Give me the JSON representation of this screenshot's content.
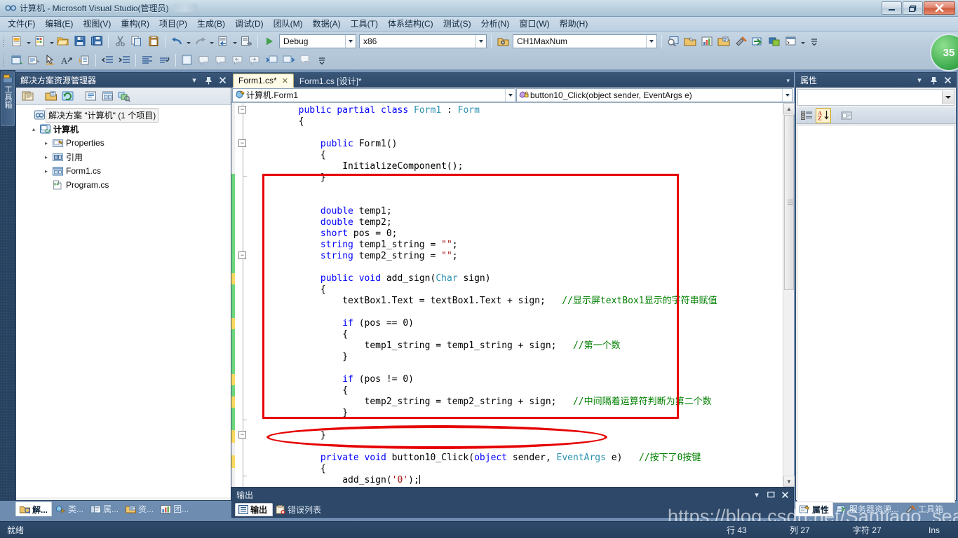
{
  "window": {
    "title": "计算机 - Microsoft Visual Studio(管理员)",
    "minimize_label": "—",
    "restore_label": "❐",
    "close_label": "✕"
  },
  "menu": {
    "items": [
      {
        "label": "文件(F)"
      },
      {
        "label": "编辑(E)"
      },
      {
        "label": "视图(V)"
      },
      {
        "label": "重构(R)"
      },
      {
        "label": "项目(P)"
      },
      {
        "label": "生成(B)"
      },
      {
        "label": "调试(D)"
      },
      {
        "label": "团队(M)"
      },
      {
        "label": "数据(A)"
      },
      {
        "label": "工具(T)"
      },
      {
        "label": "体系结构(C)"
      },
      {
        "label": "测试(S)"
      },
      {
        "label": "分析(N)"
      },
      {
        "label": "窗口(W)"
      },
      {
        "label": "帮助(H)"
      }
    ]
  },
  "toolbar": {
    "config_value": "Debug",
    "platform_value": "x86",
    "startup_project_value": "CH1MaxNum",
    "icons_row1": [
      "new-project-icon",
      "add-new-item-icon",
      "open-file-icon",
      "save-icon",
      "save-all-icon",
      "cut-icon",
      "copy-icon",
      "paste-icon",
      "undo-icon",
      "redo-icon",
      "navigate-backward-icon",
      "navigate-forward-icon",
      "start-debug-icon"
    ],
    "icons_row1_right": [
      "find-in-files-icon",
      "properties-window-icon",
      "object-browser-icon",
      "solution-explorer-icon",
      "toolbox-icon",
      "server-explorer-icon",
      "class-view-icon",
      "command-window-icon"
    ],
    "icons_row2": [
      "display-form-icon",
      "view-code-icon",
      "pointer-icon",
      "font-icon",
      "tab-order-icon",
      "decrease-indent-icon",
      "increase-indent-icon",
      "align-left-icon",
      "undo-layout-icon",
      "panel-icon",
      "comment-icon",
      "uncomment-icon",
      "bookmark-prev-icon",
      "bookmark-next-icon",
      "toggle-all-outline-icon",
      "expand-outline-icon",
      "clear-bookmarks-icon"
    ]
  },
  "badge": {
    "value": "35"
  },
  "leftdock": {
    "label": "工具箱",
    "icon": "toolbox-icon"
  },
  "solution_explorer": {
    "title": "解决方案资源管理器",
    "header_buttons": [
      "chevron-down-icon",
      "pin-icon",
      "close-icon"
    ],
    "toolbar_icons": [
      "properties-icon",
      "show-all-files-icon",
      "refresh-icon",
      "view-code-icon",
      "view-designer-icon",
      "preview-selected-items-icon"
    ],
    "tree": [
      {
        "label": "解决方案 \"计算机\" (1 个项目)",
        "icon": "solution-icon",
        "indent": 0,
        "expander": "",
        "selected": true,
        "bold": false
      },
      {
        "label": "计算机",
        "icon": "csharp-project-icon",
        "indent": 1,
        "expander": "▴",
        "selected": false,
        "bold": true
      },
      {
        "label": "Properties",
        "icon": "properties-folder-icon",
        "indent": 2,
        "expander": "▸",
        "selected": false,
        "bold": false
      },
      {
        "label": "引用",
        "icon": "references-icon",
        "indent": 2,
        "expander": "▸",
        "selected": false,
        "bold": false
      },
      {
        "label": "Form1.cs",
        "icon": "form-icon",
        "indent": 2,
        "expander": "▸",
        "selected": false,
        "bold": false
      },
      {
        "label": "Program.cs",
        "icon": "csharp-file-icon",
        "indent": 2,
        "expander": "",
        "selected": false,
        "bold": false
      }
    ]
  },
  "editor": {
    "tabs": [
      {
        "label": "Form1.cs*",
        "active": true,
        "closable": true
      },
      {
        "label": "Form1.cs [设计]*",
        "active": false,
        "closable": false
      }
    ],
    "tab_close_label": "✕",
    "tabstrip_overflow": "▾",
    "nav_type": "计算机.Form1",
    "nav_member": "button10_Click(object sender, EventArgs e)",
    "nav_type_icon": "class-icon",
    "nav_member_icon": "private-method-icon",
    "lines": [
      [
        {
          "t": "        ",
          "c": ""
        },
        {
          "t": "public",
          "c": "kw"
        },
        {
          "t": " ",
          "c": ""
        },
        {
          "t": "partial",
          "c": "kw"
        },
        {
          "t": " ",
          "c": ""
        },
        {
          "t": "class",
          "c": "kw"
        },
        {
          "t": " ",
          "c": ""
        },
        {
          "t": "Form1",
          "c": "ty"
        },
        {
          "t": " : ",
          "c": ""
        },
        {
          "t": "Form",
          "c": "ty"
        }
      ],
      [
        {
          "t": "        {",
          "c": ""
        }
      ],
      [
        {
          "t": "",
          "c": ""
        }
      ],
      [
        {
          "t": "            ",
          "c": ""
        },
        {
          "t": "public",
          "c": "kw"
        },
        {
          "t": " Form1()",
          "c": ""
        }
      ],
      [
        {
          "t": "            {",
          "c": ""
        }
      ],
      [
        {
          "t": "                InitializeComponent();",
          "c": ""
        }
      ],
      [
        {
          "t": "            }",
          "c": ""
        }
      ],
      [
        {
          "t": "",
          "c": ""
        }
      ],
      [
        {
          "t": "",
          "c": ""
        }
      ],
      [
        {
          "t": "            ",
          "c": ""
        },
        {
          "t": "double",
          "c": "kw"
        },
        {
          "t": " temp1;",
          "c": ""
        }
      ],
      [
        {
          "t": "            ",
          "c": ""
        },
        {
          "t": "double",
          "c": "kw"
        },
        {
          "t": " temp2;",
          "c": ""
        }
      ],
      [
        {
          "t": "            ",
          "c": ""
        },
        {
          "t": "short",
          "c": "kw"
        },
        {
          "t": " pos = 0;",
          "c": ""
        }
      ],
      [
        {
          "t": "            ",
          "c": ""
        },
        {
          "t": "string",
          "c": "kw"
        },
        {
          "t": " temp1_string = ",
          "c": ""
        },
        {
          "t": "\"\"",
          "c": "st"
        },
        {
          "t": ";",
          "c": ""
        }
      ],
      [
        {
          "t": "            ",
          "c": ""
        },
        {
          "t": "string",
          "c": "kw"
        },
        {
          "t": " temp2_string = ",
          "c": ""
        },
        {
          "t": "\"\"",
          "c": "st"
        },
        {
          "t": ";",
          "c": ""
        }
      ],
      [
        {
          "t": "",
          "c": ""
        }
      ],
      [
        {
          "t": "            ",
          "c": ""
        },
        {
          "t": "public",
          "c": "kw"
        },
        {
          "t": " ",
          "c": ""
        },
        {
          "t": "void",
          "c": "kw"
        },
        {
          "t": " add_sign(",
          "c": ""
        },
        {
          "t": "Char",
          "c": "ty"
        },
        {
          "t": " sign)",
          "c": ""
        }
      ],
      [
        {
          "t": "            {",
          "c": ""
        }
      ],
      [
        {
          "t": "                textBox1.Text = textBox1.Text + sign;   ",
          "c": ""
        },
        {
          "t": "//显示屏textBox1显示的字符串赋值",
          "c": "cm"
        }
      ],
      [
        {
          "t": "",
          "c": ""
        }
      ],
      [
        {
          "t": "                ",
          "c": ""
        },
        {
          "t": "if",
          "c": "kw"
        },
        {
          "t": " (pos == 0)",
          "c": ""
        }
      ],
      [
        {
          "t": "                {",
          "c": ""
        }
      ],
      [
        {
          "t": "                    temp1_string = temp1_string + sign;   ",
          "c": ""
        },
        {
          "t": "//第一个数",
          "c": "cm"
        }
      ],
      [
        {
          "t": "                }",
          "c": ""
        }
      ],
      [
        {
          "t": "",
          "c": ""
        }
      ],
      [
        {
          "t": "                ",
          "c": ""
        },
        {
          "t": "if",
          "c": "kw"
        },
        {
          "t": " (pos != 0)",
          "c": ""
        }
      ],
      [
        {
          "t": "                {",
          "c": ""
        }
      ],
      [
        {
          "t": "                    temp2_string = temp2_string + sign;   ",
          "c": ""
        },
        {
          "t": "//中间隔着运算符判断为第二个数",
          "c": "cm"
        }
      ],
      [
        {
          "t": "                }",
          "c": ""
        }
      ],
      [
        {
          "t": "",
          "c": ""
        }
      ],
      [
        {
          "t": "            }",
          "c": ""
        }
      ],
      [
        {
          "t": "",
          "c": ""
        }
      ],
      [
        {
          "t": "            ",
          "c": ""
        },
        {
          "t": "private",
          "c": "kw"
        },
        {
          "t": " ",
          "c": ""
        },
        {
          "t": "void",
          "c": "kw"
        },
        {
          "t": " button10_Click(",
          "c": ""
        },
        {
          "t": "object",
          "c": "kw"
        },
        {
          "t": " sender, ",
          "c": ""
        },
        {
          "t": "EventArgs",
          "c": "ty"
        },
        {
          "t": " e)   ",
          "c": ""
        },
        {
          "t": "//按下了0按键",
          "c": "cm"
        }
      ],
      [
        {
          "t": "            {",
          "c": ""
        }
      ],
      [
        {
          "t": "                add_sign(",
          "c": ""
        },
        {
          "t": "'0'",
          "c": "st"
        },
        {
          "t": ");",
          "c": ""
        },
        {
          "t": "|CARET|",
          "c": "caret"
        }
      ],
      [
        {
          "t": "            }",
          "c": ""
        }
      ]
    ],
    "annotations": [
      {
        "shape": "rect",
        "name": "red-highlight-rectangle"
      },
      {
        "shape": "ellipse",
        "name": "red-highlight-ellipse"
      }
    ],
    "scrollbar": {
      "up": "▲",
      "down": "▼"
    }
  },
  "output_pane": {
    "title": "输出",
    "header_buttons": [
      "chevron-down-icon",
      "restore-icon",
      "close-icon"
    ],
    "tabs": [
      {
        "label": "输出",
        "icon": "output-icon",
        "active": true
      },
      {
        "label": "错误列表",
        "icon": "error-list-icon",
        "active": false
      }
    ]
  },
  "properties_pane": {
    "title": "属性",
    "header_buttons": [
      "chevron-down-icon",
      "pin-icon",
      "close-icon"
    ],
    "selected_object": "",
    "toolbar_icons": [
      "categorized-icon",
      "alphabetical-icon",
      "properties-page-icon"
    ]
  },
  "dock_tabs_bottom_left": [
    {
      "label": "解...",
      "icon": "solution-explorer-icon",
      "active": true
    },
    {
      "label": "类...",
      "icon": "class-view-icon",
      "active": false
    },
    {
      "label": "属...",
      "icon": "properties-icon",
      "active": false
    },
    {
      "label": "资...",
      "icon": "resource-view-icon",
      "active": false
    },
    {
      "label": "团...",
      "icon": "team-explorer-icon",
      "active": false
    }
  ],
  "dock_tabs_bottom_right": [
    {
      "label": "属性",
      "icon": "properties-icon",
      "active": true
    },
    {
      "label": "服务器资源...",
      "icon": "server-explorer-icon",
      "active": false
    },
    {
      "label": "工具箱",
      "icon": "toolbox-icon",
      "active": false
    }
  ],
  "statusbar": {
    "state": "就绪",
    "line": "行 43",
    "column": "列 27",
    "character": "字符 27",
    "insert_mode": "Ins"
  },
  "watermark": "https://blog.csdn.net/Santiago_sea",
  "colors": {
    "accent_red": "#e60000",
    "keyword_blue": "#0000ff",
    "type_teal": "#2b91af",
    "comment_green": "#008000",
    "string_red": "#a31515",
    "chrome_blue": "#2d4868"
  }
}
